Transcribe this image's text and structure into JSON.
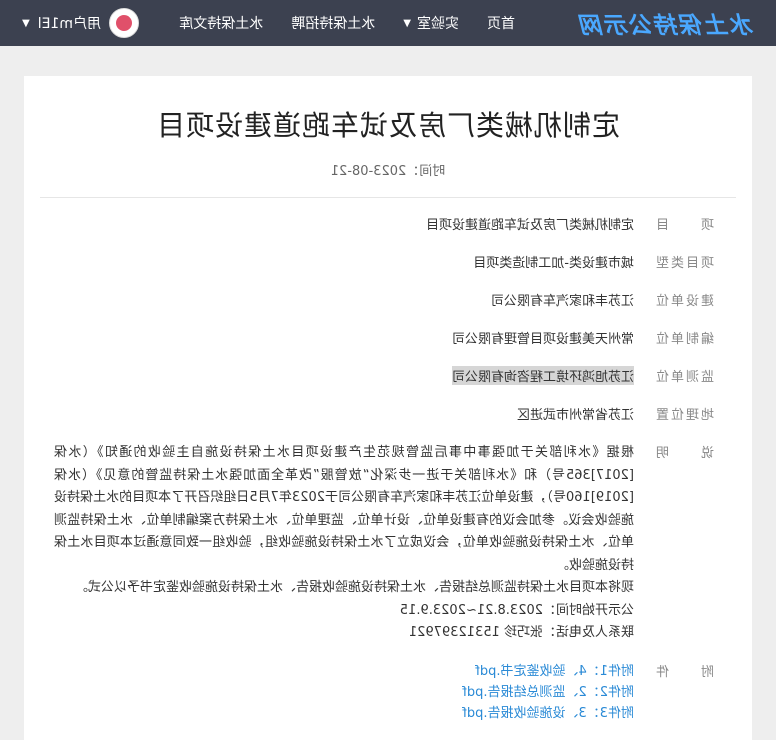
{
  "header": {
    "logo": "水土保持公示网",
    "nav": [
      {
        "label": "首页",
        "has_caret": false
      },
      {
        "label": "实验室",
        "has_caret": true
      },
      {
        "label": "水土保持招聘",
        "has_caret": false
      },
      {
        "label": "水土保持文库",
        "has_caret": false
      }
    ],
    "user": "用户m1El"
  },
  "article": {
    "title": "定制机械类厂房及试车跑道建设项目",
    "date": "时间：2023-08-21"
  },
  "fields": [
    {
      "label": "项　　目",
      "value": "定制机械类厂房及试车跑道建设项目"
    },
    {
      "label": "项目类型",
      "value": "城市建设类-加工制造类项目"
    },
    {
      "label": "建设单位",
      "value": "江苏丰和家汽车有限公司"
    },
    {
      "label": "编制单位",
      "value": "常州天美建设项目管理有限公司"
    },
    {
      "label": "监测单位",
      "value": "江苏旭鸿环境工程咨询有限公司"
    },
    {
      "label": "地理位置",
      "value": "江苏省常州市武进区"
    }
  ],
  "description": {
    "label": "说　　明",
    "paragraphs": [
      "根据《水利部关于加强事中事后监管规范生产建设项目水土保持设施自主验收的通知》（水保[2017]365号）和《水利部关于进一步深化“放管服”改革全面加强水土保持监管的意见》（水保[2019]160号），建设单位江苏丰和家汽车有限公司于2023年7月5日组织召开了本项目的水土保持设施验收会议。参加会议的有建设单位、设计单位、监理单位、水土保持方案编制单位、水土保持监测单位、水土保持设施验收单位，会议成立了水土保持设施验收组，验收组一致同意通过本项目水土保持设施验收。",
      "现将本项目水土保持监测总结报告、水土保持设施验收报告、水土保持设施验收鉴定书予以公式。",
      "公示开始时间：2023.8.21~2023.9.15",
      "联系人及电话：张巧珍 15312397921"
    ]
  },
  "attachments": {
    "label": "附　　件",
    "items": [
      "附件1：4、验收鉴定书.pdf",
      "附件2：2、监测总结报告.pdf",
      "附件3：3、设施验收报告.pdf"
    ]
  },
  "colors": {
    "topbar": "#3c4150",
    "logo": "#4aa8ff",
    "link": "#2a8ad6"
  }
}
